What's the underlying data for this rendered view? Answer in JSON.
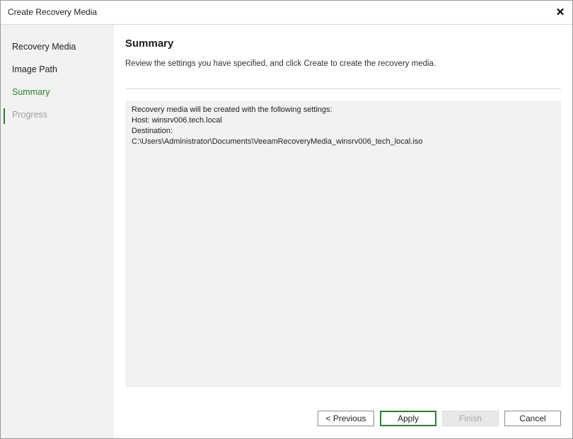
{
  "window": {
    "title": "Create Recovery Media",
    "close_glyph": "✕"
  },
  "sidebar": {
    "items": [
      {
        "label": "Recovery Media",
        "state": "normal"
      },
      {
        "label": "Image Path",
        "state": "normal"
      },
      {
        "label": "Summary",
        "state": "active"
      },
      {
        "label": "Progress",
        "state": "disabled"
      }
    ]
  },
  "main": {
    "title": "Summary",
    "description": "Review the settings you have specified, and click Create to create the recovery media.",
    "summary_lines": [
      "Recovery media will be created with the following settings:",
      "Host: winsrv006.tech.local",
      "Destination:",
      "C:\\Users\\Administrator\\Documents\\VeeamRecoveryMedia_winsrv006_tech_local.iso"
    ]
  },
  "buttons": {
    "previous": "< Previous",
    "apply": "Apply",
    "finish": "Finish",
    "cancel": "Cancel"
  },
  "colors": {
    "accent": "#2e7d32",
    "sidebar_bg": "#f1f2f1",
    "summary_bg": "#f1f2f1",
    "disabled_text": "#a0a0a0"
  }
}
